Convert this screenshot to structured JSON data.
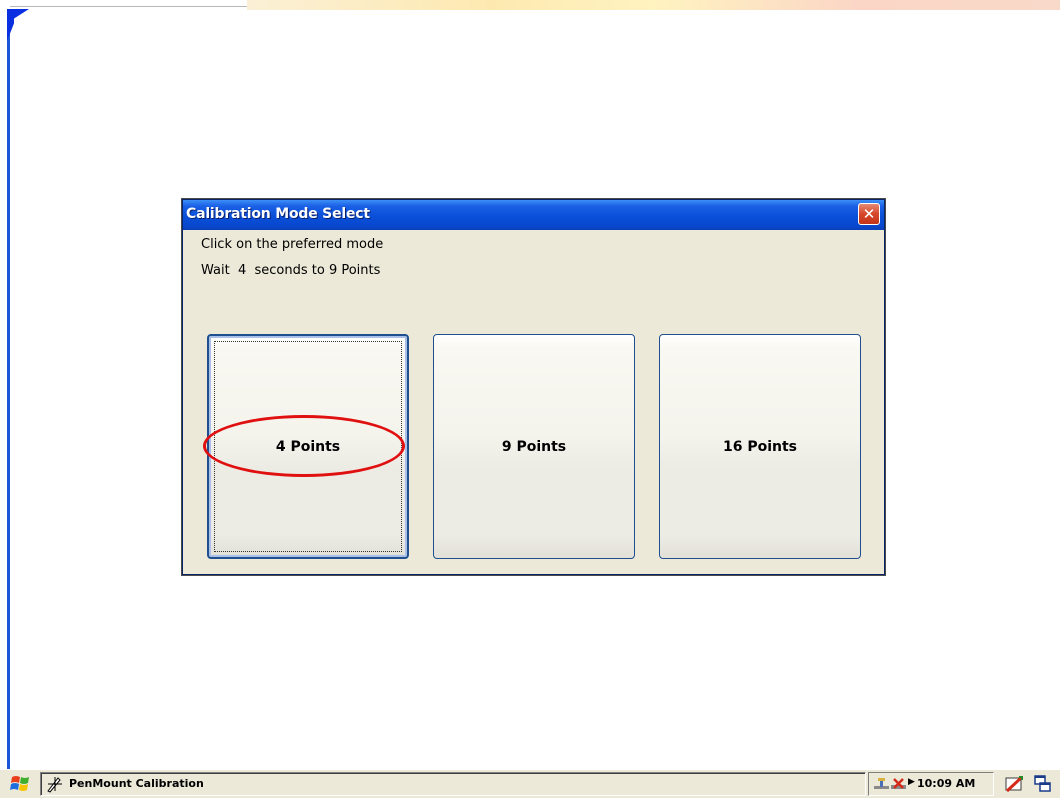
{
  "dialog": {
    "title": "Calibration Mode Select",
    "close_glyph": "✕",
    "instruction": "Click on the preferred mode",
    "countdown": "Wait  4  seconds to 9 Points",
    "buttons": [
      {
        "label": "4 Points"
      },
      {
        "label": "9 Points"
      },
      {
        "label": "16 Points"
      }
    ]
  },
  "taskbar": {
    "start_icon": "windows-flag-icon",
    "task_label": "PenMount Calibration",
    "task_icon": "pen-icon",
    "tray_icons": [
      "network-icon",
      "volume-icon"
    ],
    "clock": "10:09 AM",
    "extra_icons": [
      "input-panel-icon",
      "desktop-icon"
    ]
  },
  "colors": {
    "titlebar": "#0a4fd8",
    "highlight": "#e01010",
    "accent": "#1f4f8f"
  }
}
